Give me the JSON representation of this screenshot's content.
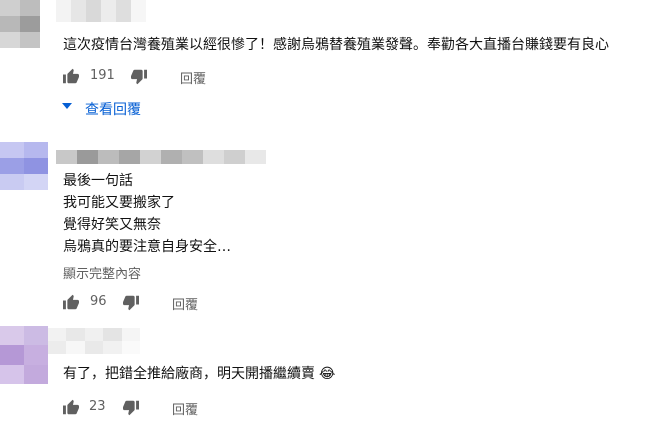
{
  "comments": [
    {
      "text_lines": [
        "這次疫情台灣養殖業以經很慘了！感謝烏鴉替養殖業發聲。奉勸各大直播台賺錢要有良心"
      ],
      "likes": "191",
      "reply_label": "回覆",
      "view_replies_label": "查看回覆"
    },
    {
      "text_lines": [
        "最後一句話",
        "我可能又要搬家了",
        "覺得好笑又無奈",
        "烏鴉真的要注意自身安全…"
      ],
      "show_more_label": "顯示完整內容",
      "likes": "96",
      "reply_label": "回覆"
    },
    {
      "text_lines": [
        "有了，把錯全推給廠商，明天開播繼續賣"
      ],
      "emoji": "😂",
      "likes": "23",
      "reply_label": "回覆"
    }
  ],
  "colors": {
    "text": "#111111",
    "secondary": "#606060",
    "link": "#065fd4"
  },
  "icons": [
    "thumbs-up-icon",
    "thumbs-down-icon",
    "caret-down-icon"
  ]
}
